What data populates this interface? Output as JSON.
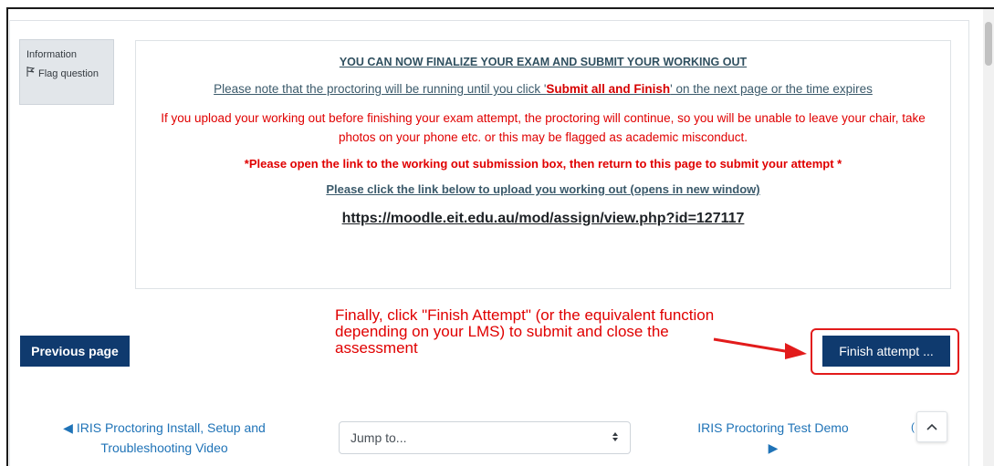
{
  "info_panel": {
    "title": "Information",
    "flag_icon": "flag-icon",
    "flag_label": "Flag question"
  },
  "question": {
    "heading": "YOU CAN NOW FINALIZE YOUR EXAM AND SUBMIT YOUR WORKING OUT",
    "note_prefix": "Please note that the proctoring will be running until you click '",
    "note_emphasis": "Submit all and Finish",
    "note_suffix": "'  on the next page or the time expires",
    "warning": "If you upload your working out before finishing your exam attempt, the proctoring will continue, so you will be unable to leave your chair, take photos on your phone etc. or this may be flagged as academic misconduct.",
    "instruction": "*Please open the link to the working out submission box, then return to this page to submit your attempt *",
    "link_caption": "Please click the link below to upload you working out (opens in new window)",
    "link_url": "https://moodle.eit.edu.au/mod/assign/view.php?id=127117"
  },
  "actions": {
    "previous_label": "Previous page",
    "finish_label": "Finish attempt ..."
  },
  "annotation": {
    "callout_text": "Finally, click \"Finish Attempt\" (or the equivalent function depending on your LMS) to submit and close the assessment",
    "color": "#e00000"
  },
  "activity_nav": {
    "prev_arrow": "◀",
    "prev_link": "IRIS Proctoring Install, Setup and Troubleshooting Video",
    "jump_placeholder": "Jump to...",
    "next_link": "IRIS Proctoring Test Demo",
    "next_arrow": "▶",
    "back_to_top_icon": "chevron-up-icon",
    "partial_text": "("
  },
  "colors": {
    "primary": "#0f3a6e",
    "link": "#1f73b7",
    "warning": "#e00000"
  }
}
